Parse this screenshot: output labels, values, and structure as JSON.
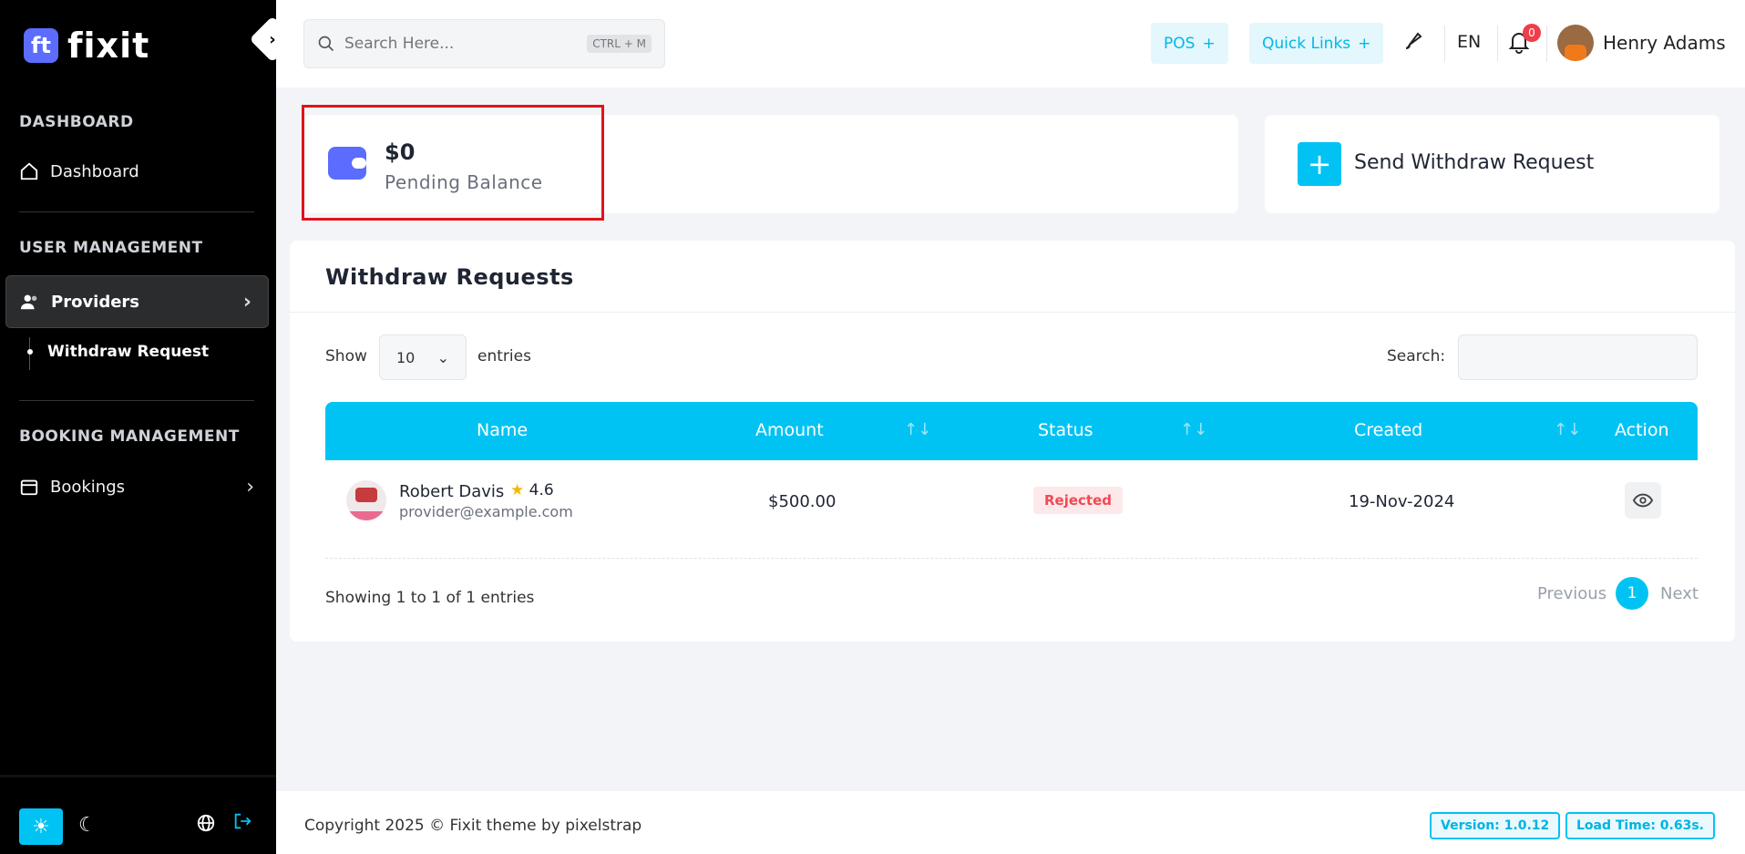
{
  "sidebar": {
    "logo_mark": "ft",
    "logo_text": "fixit",
    "collapse_icon": "›",
    "sections": [
      {
        "title": "DASHBOARD",
        "items": [
          {
            "label": "Dashboard"
          }
        ]
      },
      {
        "title": "USER MANAGEMENT",
        "items": [
          {
            "label": "Providers",
            "sub": [
              {
                "label": "Withdraw Request"
              }
            ]
          }
        ]
      },
      {
        "title": "BOOKING MANAGEMENT",
        "items": [
          {
            "label": "Bookings"
          }
        ]
      }
    ]
  },
  "header": {
    "search_placeholder": "Search Here...",
    "search_shortcut": "CTRL + M",
    "pos_label": "POS",
    "quick_links_label": "Quick Links",
    "language": "EN",
    "notification_count": "0",
    "user_name": "Henry Adams"
  },
  "balance": {
    "amount": "$0",
    "label": "Pending Balance"
  },
  "withdraw_button": {
    "label": "Send Withdraw Request",
    "plus": "+"
  },
  "table": {
    "title": "Withdraw Requests",
    "show_label": "Show",
    "page_size": "10",
    "entries_label": "entries",
    "search_label": "Search:",
    "columns": [
      "Name",
      "Amount",
      "Status",
      "Created",
      "Action"
    ],
    "rows": [
      {
        "name": "Robert Davis",
        "rating": "4.6",
        "email": "provider@example.com",
        "amount": "$500.00",
        "status": "Rejected",
        "created": "19-Nov-2024"
      }
    ],
    "showing": "Showing 1 to 1 of 1 entries",
    "pagination": {
      "previous": "Previous",
      "current": "1",
      "next": "Next"
    }
  },
  "footer": {
    "copyright": "Copyright 2025 © Fixit theme by pixelstrap",
    "version": "Version: 1.0.12",
    "load_time": "Load Time: 0.63s."
  },
  "colors": {
    "accent": "#00c3f4",
    "brand": "#5c6cff",
    "danger": "#ef4a54",
    "highlight": "#e0131b"
  }
}
